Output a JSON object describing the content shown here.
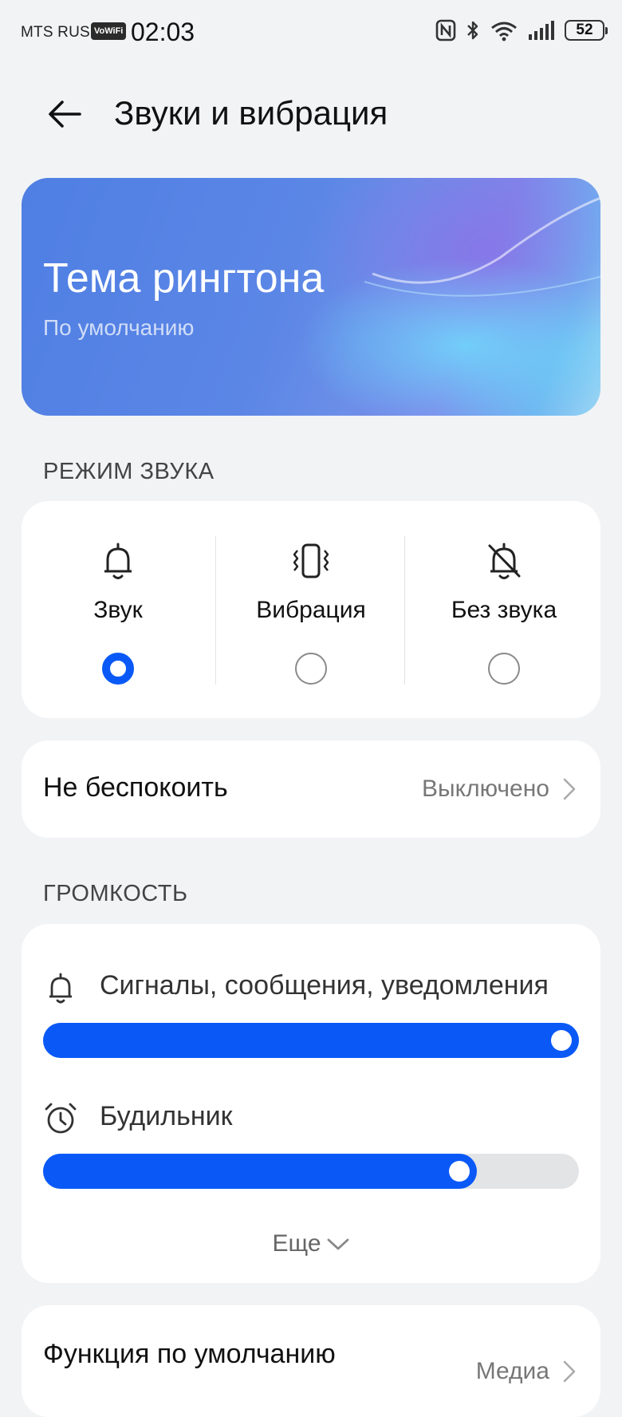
{
  "status_bar": {
    "carrier": "MTS RUS",
    "vowifi": "VoWiFi",
    "time": "02:03",
    "battery": "52"
  },
  "header": {
    "title": "Звуки и вибрация"
  },
  "banner": {
    "title": "Тема рингтона",
    "subtitle": "По умолчанию"
  },
  "sound_mode": {
    "section_label": "РЕЖИМ ЗВУКА",
    "options": [
      {
        "label": "Звук",
        "selected": true
      },
      {
        "label": "Вибрация",
        "selected": false
      },
      {
        "label": "Без звука",
        "selected": false
      }
    ]
  },
  "dnd": {
    "label": "Не беспокоить",
    "value": "Выключено"
  },
  "volume": {
    "section_label": "ГРОМКОСТЬ",
    "sliders": [
      {
        "label": "Сигналы, сообщения, уведомления",
        "level": 1.0
      },
      {
        "label": "Будильник",
        "level": 0.81
      }
    ],
    "more_label": "Еще"
  },
  "default_function": {
    "label": "Функция по умолчанию",
    "value": "Медиа"
  },
  "colors": {
    "accent": "#0a59f7",
    "background": "#f1f3f5"
  }
}
